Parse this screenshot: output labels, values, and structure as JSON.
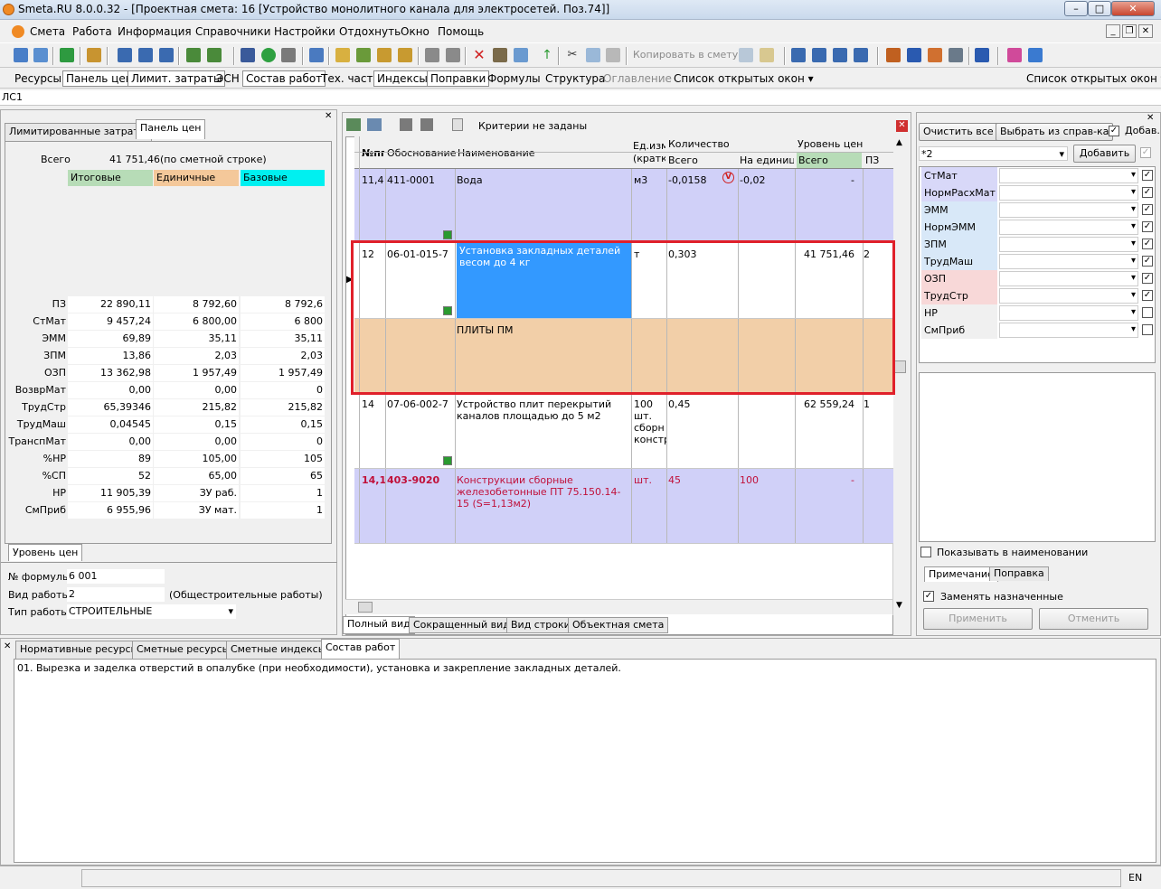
{
  "window": {
    "title": "Smeta.RU  8.0.0.32  - [Проектная смета: 16 [Устройство монолитного канала для электросетей. Поз.74]]"
  },
  "menu": [
    "Смета",
    "Работа",
    "Информация",
    "Справочники",
    "Настройки",
    "Отдохнуть",
    "Окно",
    "Помощь"
  ],
  "toolbar": {
    "copy_label": "Копировать в смету"
  },
  "tabs2": [
    "Ресурсы",
    "Панель цен",
    "Лимит. затраты",
    "ЭСН",
    "Состав работ",
    "Тех. часть",
    "Индексы",
    "Поправки",
    "Формулы",
    "Структура",
    "Оглавление",
    "Список открытых окон ▾",
    "Список открытых окон ▾"
  ],
  "ls_label": "ЛС1",
  "left": {
    "tabs": [
      "Лимитированные затраты",
      "Панель цен"
    ],
    "total_label": "Всего",
    "total_value": "41 751,46",
    "total_note": "(по сметной строке)",
    "headers": [
      "Итоговые",
      "Единичные",
      "Базовые"
    ],
    "rows": [
      {
        "name": "ПЗ",
        "v": [
          "22 890,11",
          "8 792,60",
          "8 792,6"
        ]
      },
      {
        "name": "СтМат",
        "v": [
          "9 457,24",
          "6 800,00",
          "6 800"
        ]
      },
      {
        "name": "ЭММ",
        "v": [
          "69,89",
          "35,11",
          "35,11"
        ]
      },
      {
        "name": "ЗПМ",
        "v": [
          "13,86",
          "2,03",
          "2,03"
        ]
      },
      {
        "name": "ОЗП",
        "v": [
          "13 362,98",
          "1 957,49",
          "1 957,49"
        ]
      },
      {
        "name": "ВозврМат",
        "v": [
          "0,00",
          "0,00",
          "0"
        ]
      },
      {
        "name": "ТрудСтр",
        "v": [
          "65,39346",
          "215,82",
          "215,82"
        ]
      },
      {
        "name": "ТрудМаш",
        "v": [
          "0,04545",
          "0,15",
          "0,15"
        ]
      },
      {
        "name": "ТранспМат",
        "v": [
          "0,00",
          "0,00",
          "0"
        ]
      },
      {
        "name": "%НР",
        "v": [
          "89",
          "105,00",
          "105"
        ]
      },
      {
        "name": "%СП",
        "v": [
          "52",
          "65,00",
          "65"
        ]
      },
      {
        "name": "НР",
        "v": [
          "11 905,39",
          "ЗУ раб.",
          "1"
        ]
      },
      {
        "name": "СмПриб",
        "v": [
          "6 955,96",
          "ЗУ мат.",
          "1"
        ]
      }
    ],
    "bottom_tab": "Уровень цен",
    "formula_label": "№ формулы",
    "formula_value": "6 001",
    "work_type_label": "Вид работы",
    "work_type_value": "2",
    "work_type_note": "(Общестроительные работы)",
    "work_kind_label": "Тип работы",
    "work_kind_value": "СТРОИТЕЛЬНЫЕ"
  },
  "grid": {
    "criteria": "Критерии не заданы",
    "headers": {
      "num": "№пп",
      "basis": "Обоснование",
      "name": "Наименование",
      "unit": "Ед.изм (кратк",
      "qty": "Количество",
      "qty_total": "Всего",
      "qty_unit": "На единицу",
      "price": "Уровень цен",
      "price_total": "Всего",
      "pz": "ПЗ"
    },
    "rows": [
      {
        "num": "11,4",
        "basis": "411-0001",
        "name": "Вода",
        "unit": "м3",
        "qty": "-0,0158",
        "per": "-0,02",
        "total": "-",
        "pz": ""
      },
      {
        "num": "12",
        "basis": "06-01-015-7",
        "name": "Установка закладных деталей весом до 4 кг",
        "unit": "т",
        "qty": "0,303",
        "per": "",
        "total": "41 751,46",
        "pz": "2"
      },
      {
        "num": "",
        "basis": "",
        "name": "ПЛИТЫ ПМ",
        "unit": "",
        "qty": "",
        "per": "",
        "total": "",
        "pz": ""
      },
      {
        "num": "14",
        "basis": "07-06-002-7",
        "name": "Устройство плит перекрытий каналов площадью до 5 м2",
        "unit": "100 шт. сборн констр",
        "qty": "0,45",
        "per": "",
        "total": "62 559,24",
        "pz": "1"
      },
      {
        "num": "14,1",
        "basis": "403-9020",
        "name": "Конструкции сборные железобетонные ПТ 75.150.14-15 (S=1,13м2)",
        "unit": "шт.",
        "qty": "45",
        "per": "100",
        "total": "-",
        "pz": ""
      }
    ],
    "view_tabs": [
      "Полный вид",
      "Сокращенный вид",
      "Вид строки",
      "Объектная смета"
    ]
  },
  "right": {
    "clear_btn": "Очистить все",
    "choose_btn": "Выбрать из справ-ка",
    "add_check": "Добав.",
    "combo_value": "*2",
    "add_btn": "Добавить",
    "items": [
      "СтМат",
      "НормРасхМат",
      "ЭММ",
      "НормЭММ",
      "ЗПМ",
      "ТрудМаш",
      "ОЗП",
      "ТрудСтр",
      "НР",
      "СмПриб"
    ],
    "show_in_name": "Показывать в наименовании",
    "tabs": [
      "Примечание",
      "Поправка"
    ],
    "replace_label": "Заменять назначенные",
    "apply_btn": "Применить",
    "cancel_btn": "Отменить"
  },
  "bottom": {
    "tabs": [
      "Нормативные ресурсы",
      "Сметные ресурсы",
      "Сметные индексы",
      "Состав работ"
    ],
    "text": "01. Вырезка и заделка отверстий в опалубке (при необходимости), установка и закрепление закладных деталей."
  },
  "status": {
    "lang": "EN"
  }
}
